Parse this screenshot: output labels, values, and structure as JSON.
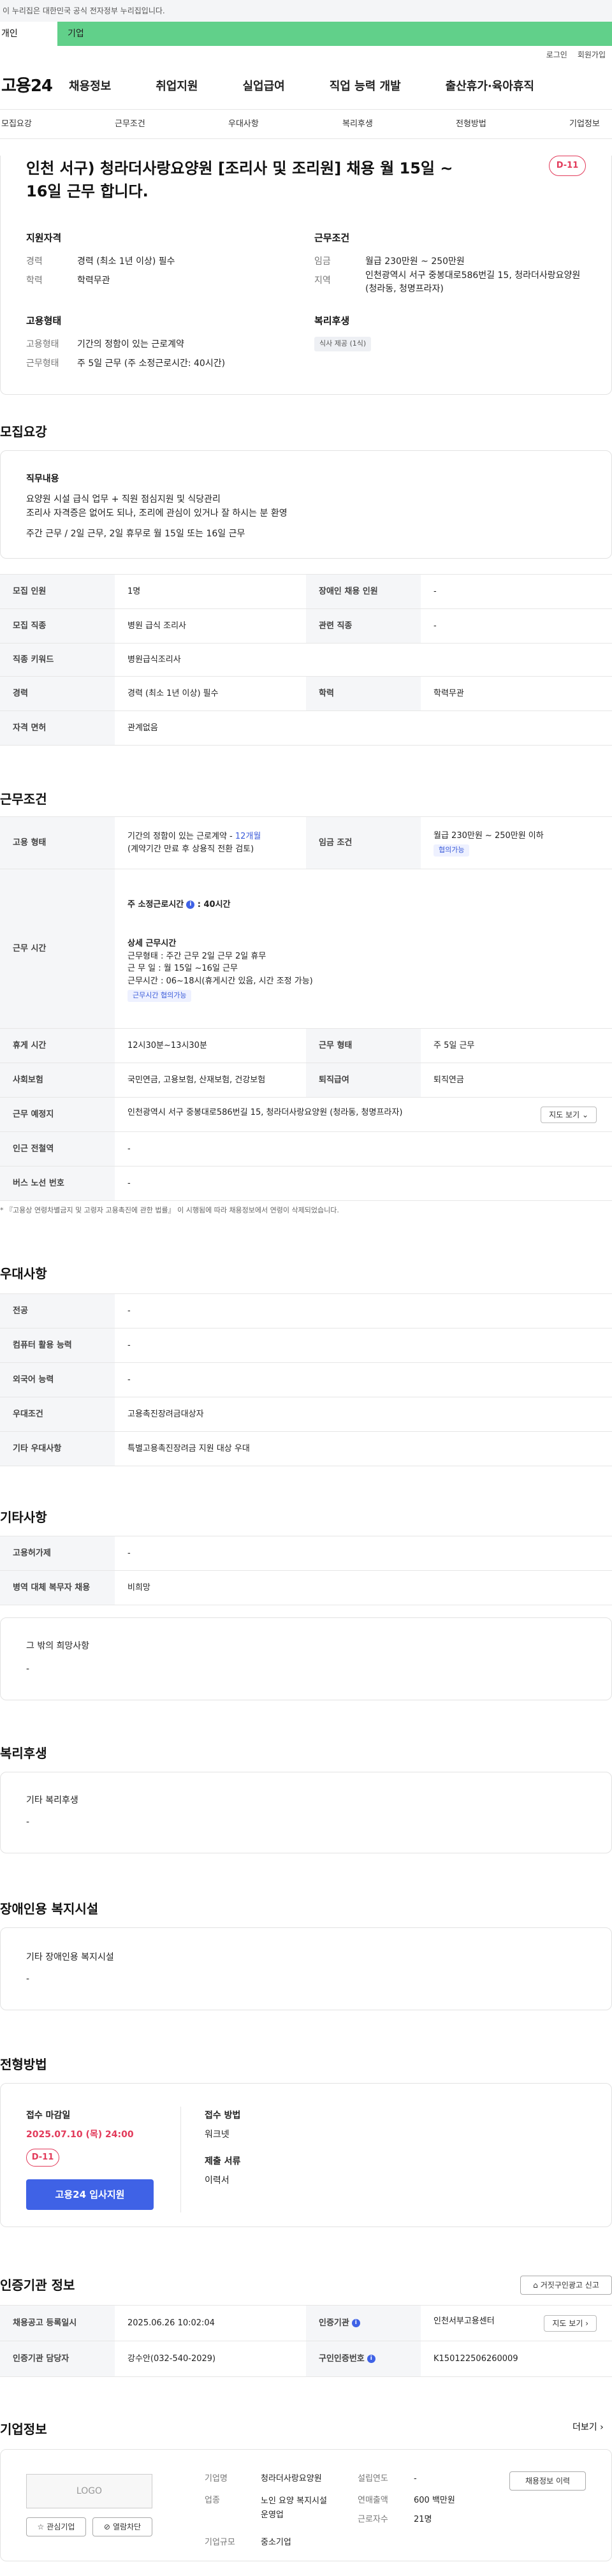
{
  "gov_banner": "이 누리집은 대한민국 공식 전자정부 누리집입니다.",
  "tabs": [
    "개인",
    "기업"
  ],
  "util": [
    "로그인",
    "회원가입"
  ],
  "logo": "고용24",
  "gnb": [
    "채용정보",
    "취업지원",
    "실업급여",
    "직업 능력 개발",
    "출산휴가·육아휴직"
  ],
  "anchors": [
    "모집요강",
    "근무조건",
    "우대사항",
    "복리후생",
    "전형방법",
    "기업정보"
  ],
  "job": {
    "title": "인천 서구) 청라더사랑요양원 [조리사 및 조리원] 채용 월 15일 ~ 16일 근무 합니다.",
    "dday": "D-11",
    "qual_title": "지원자격",
    "cond_title": "근무조건",
    "type_title": "고용형태",
    "welfare_title": "복리후생",
    "career_lbl": "경력",
    "career_val": "경력 (최소 1년 이상) 필수",
    "edu_lbl": "학력",
    "edu_val": "학력무관",
    "wage_lbl": "임금",
    "wage_val": "월급 230만원 ~ 250만원",
    "area_lbl": "지역",
    "area_val": "인천광역시 서구 중봉대로586번길 15, 청라더사랑요양원 (청라동, 청명프라자)",
    "emp_lbl": "고용형태",
    "emp_val": "기간의 정함이 있는 근로계약",
    "hours_lbl": "근무형태",
    "hours_val": "주 5일 근무 (주 소정근로시간: 40시간)",
    "welfare_chip": "식사 제공 (1식)"
  },
  "recruit": {
    "section": "모집요강",
    "duty_title": "직무내용",
    "duty_lines": [
      "요양원 시설 급식 업무 + 직원 점심지원 및 식당관리",
      "조리사 자격증은 없어도 되나, 조리에 관심이 있거나 잘 하시는 분 환영",
      "주간 근무 / 2일 근무, 2일 휴무로  월 15일 또는 16일 근무"
    ],
    "rows": [
      [
        "모집 인원",
        "1명",
        "장애인 채용 인원",
        "-"
      ],
      [
        "모집 직종",
        "병원 급식 조리사",
        "관련 직종",
        "-"
      ],
      [
        "직종 키워드",
        "병원급식조리사"
      ],
      [
        "경력",
        "경력 (최소 1년 이상) 필수",
        "학력",
        "학력무관"
      ],
      [
        "자격 면허",
        "관계없음"
      ]
    ]
  },
  "conditions": {
    "section": "근무조건",
    "emp_h": "고용 형태",
    "emp_v1": "기간의 정함이 있는 근로계약 - ",
    "emp_v1b": "12개월",
    "emp_v2": "(계약기간 만료 후 상용직 전환 검토)",
    "wage_h": "임금 조건",
    "wage_v": "월급 230만원 ~ 250만원 이하",
    "wage_tag": "협의가능",
    "time_h": "근무 시간",
    "time_title": "주 소정근로시간",
    "time_hours": ": 40시간",
    "detail_title": "상세 근무시간",
    "detail_lines": [
      "근무형태 : 주간 근무 2일 근무 2일 휴무",
      "근 무 일 : 월 15일 ~16일 근무",
      "근무시간 : 06~18시(휴게시간 있음, 시간 조정 가능)"
    ],
    "time_tag": "근무시간 협의가능",
    "rows": [
      [
        "휴게 시간",
        "12시30분~13시30분",
        "근무 형태",
        "주 5일 근무"
      ],
      [
        "사회보험",
        "국민연금, 고용보험, 산재보험, 건강보험",
        "퇴직급여",
        "퇴직연금"
      ]
    ],
    "place_h": "근무 예정지",
    "place_v": "인천광역시 서구 중봉대로586번길 15, 청라더사랑요양원 (청라동, 청명프라자)",
    "map": "지도 보기",
    "station_h": "인근 전철역",
    "station_v": "-",
    "bus_h": "버스 노선 번호",
    "bus_v": "-",
    "note": "* 『고용상 연령차별금지 및 고령자 고용촉진에 관한 법률』 이 시행됨에 따라 채용정보에서 연령이 삭제되었습니다."
  },
  "pref": {
    "section": "우대사항",
    "rows": [
      [
        "전공",
        "-"
      ],
      [
        "컴퓨터 활용 능력",
        "-"
      ],
      [
        "외국어 능력",
        "-"
      ],
      [
        "우대조건",
        "고용촉진장려금대상자"
      ],
      [
        "기타 우대사항",
        "특별고용촉진장려금 지원 대상 우대"
      ]
    ]
  },
  "etc": {
    "section": "기타사항",
    "rows": [
      [
        "고용허가제",
        "-"
      ],
      [
        "병역 대체 복무자 채용",
        "비희망"
      ]
    ],
    "wish_title": "그 밖의 희망사항",
    "wish_val": "-"
  },
  "welfare": {
    "section": "복리후생",
    "box_title": "기타 복리후생",
    "box_val": "-"
  },
  "disabled": {
    "section": "장애인용 복지시설",
    "box_title": "기타 장애인용 복지시설",
    "box_val": "-"
  },
  "process": {
    "section": "전형방법",
    "deadline_title": "접수 마감일",
    "deadline": "2025.07.10 (목) 24:00",
    "dday": "D-11",
    "apply": "고용24 입사지원",
    "method_title": "접수 방법",
    "method": "워크넷",
    "docs_title": "제출 서류",
    "docs": "이력서"
  },
  "auth": {
    "section": "인증기관 정보",
    "report": "거짓구인광고 신고",
    "rows": [
      [
        "채용공고 등록일시",
        "2025.06.26 10:02:04",
        "인증기관",
        "인천서부고용센터"
      ],
      [
        "인증기관 담당자",
        "강수안(032-540-2029)",
        "구인인증번호",
        "K150122506260009"
      ]
    ],
    "map": "지도 보기"
  },
  "company": {
    "section": "기업정보",
    "more": "더보기",
    "logo": "LOGO",
    "fav": "관심기업",
    "block": "열람차단",
    "history": "채용정보 이력",
    "name_l": "기업명",
    "name_v": "청라더사랑요양원",
    "biz_l": "업종",
    "biz_v": "노인 요양 복지시설 운영업",
    "size_l": "기업규모",
    "size_v": "중소기업",
    "year_l": "설립연도",
    "year_v": "-",
    "sales_l": "연매출액",
    "sales_v": "600 백만원",
    "emp_l": "근로자수",
    "emp_v": "21명"
  }
}
